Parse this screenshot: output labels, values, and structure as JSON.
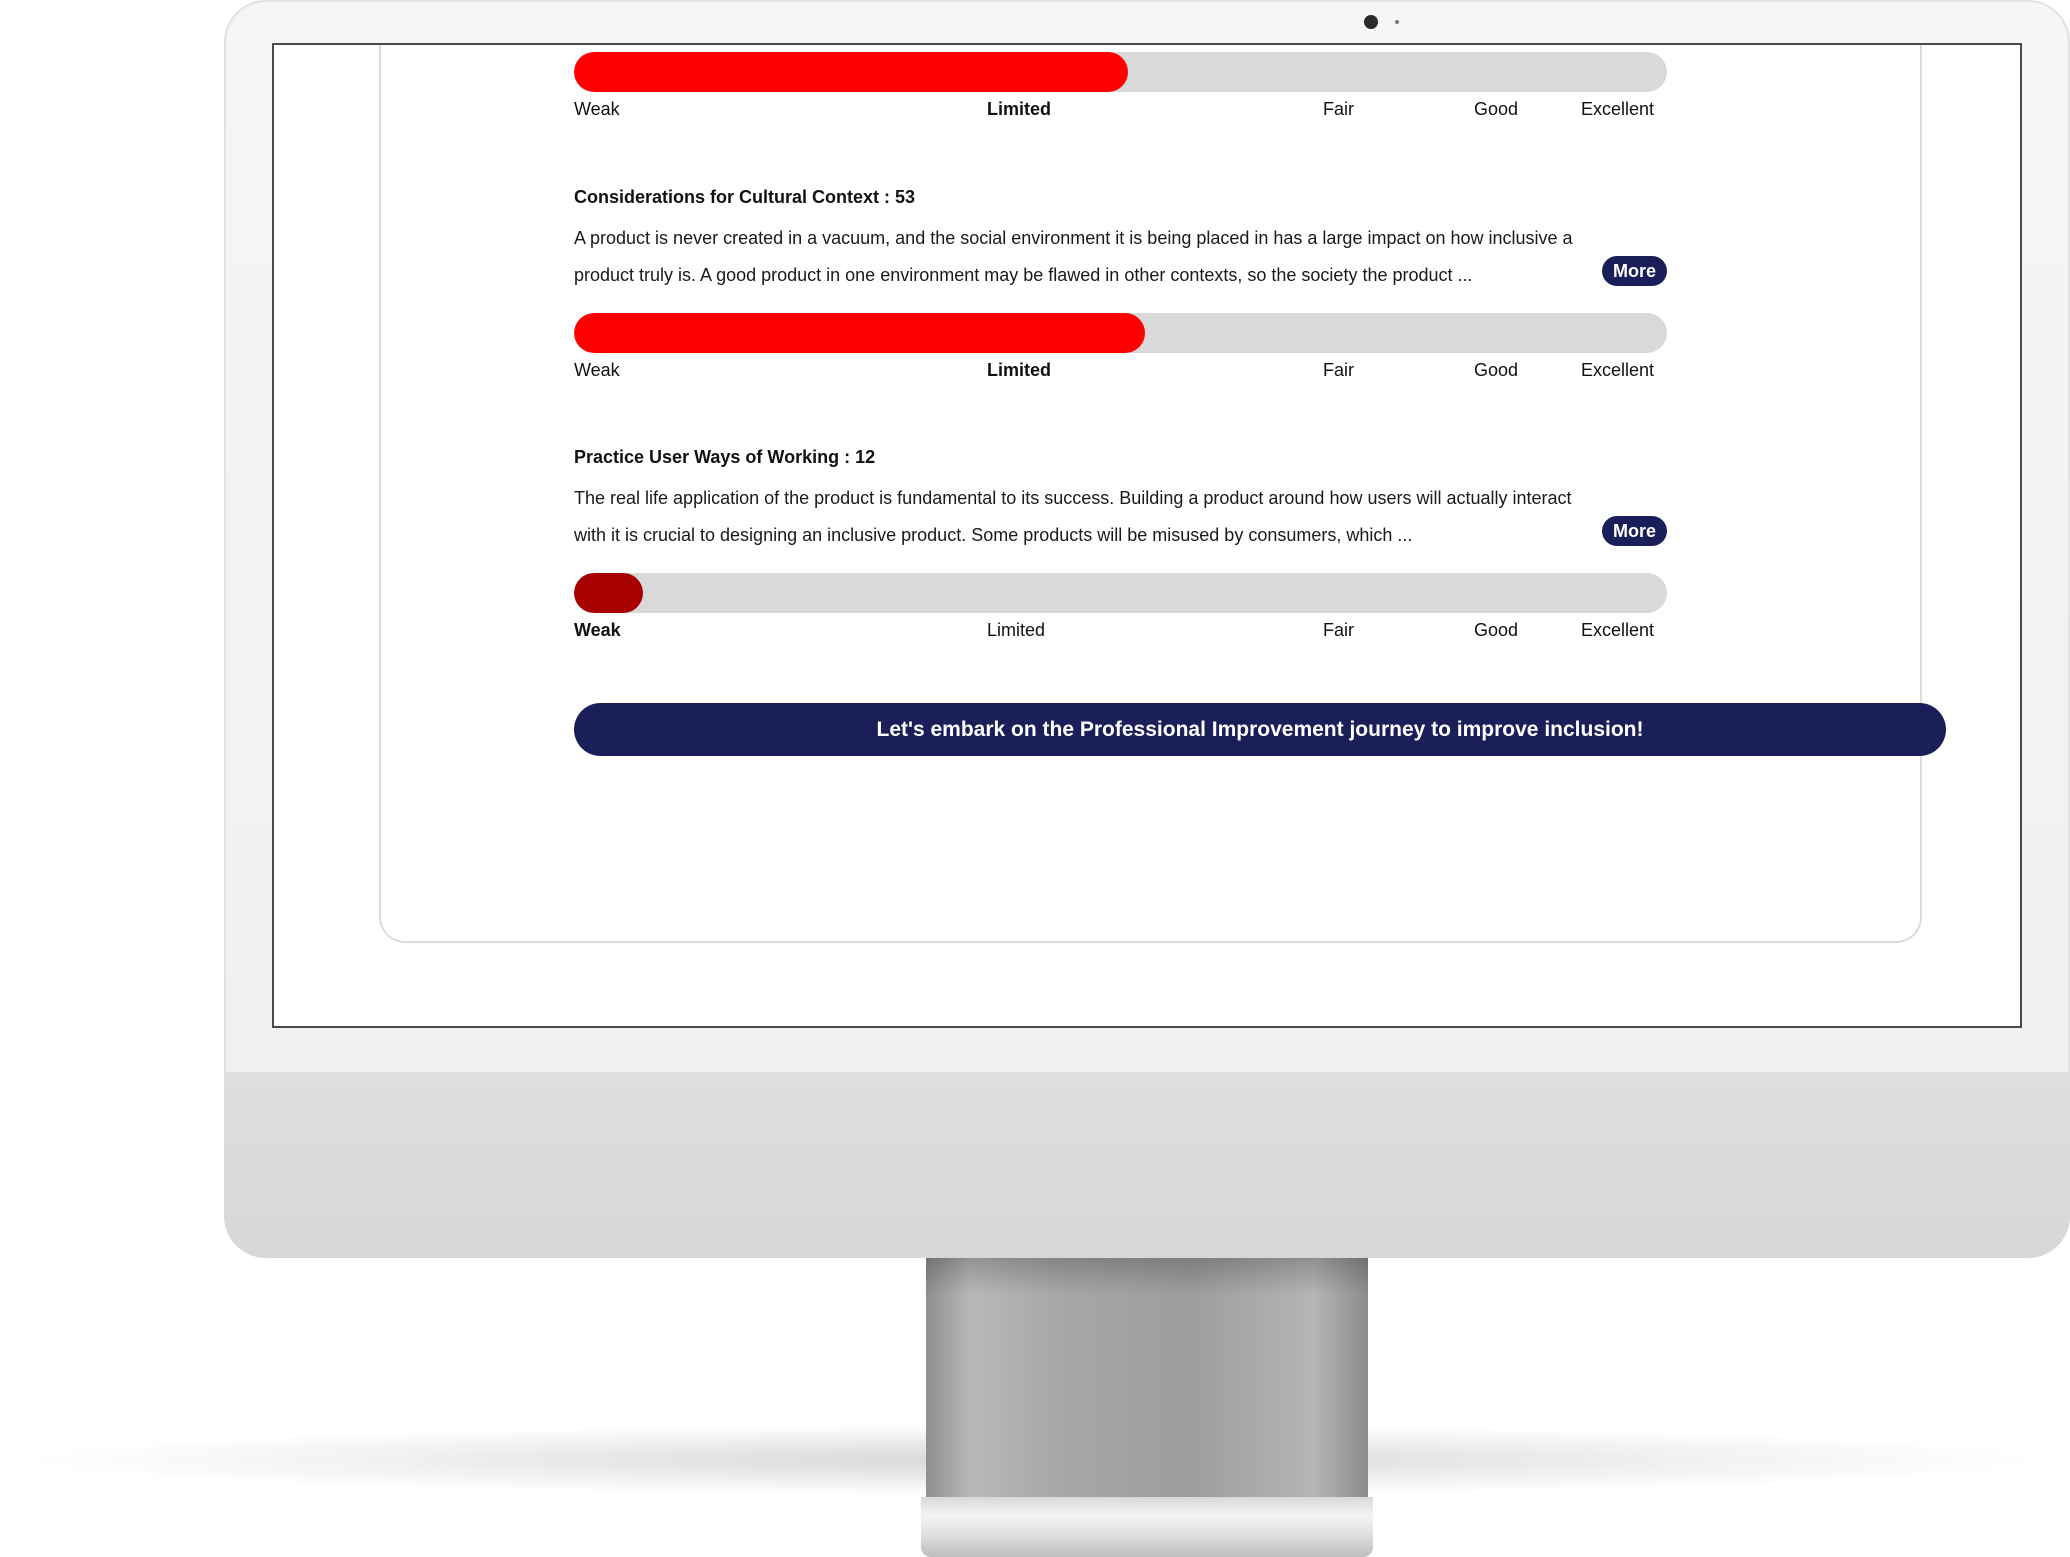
{
  "levels": [
    "Weak",
    "Limited",
    "Fair",
    "Good",
    "Excellent"
  ],
  "sections": [
    {
      "title": "",
      "description": "",
      "more_label": "",
      "progress_fraction": 0.507,
      "active_level": "Limited",
      "fill_color": "#ff0000"
    },
    {
      "title": "Considerations for Cultural Context : 53",
      "description": "A product is never created in a vacuum, and the social environment it is being placed in has a large impact on how inclusive a product truly is. A good product in one environment may be flawed in other contexts, so the society the product ...",
      "more_label": "More",
      "progress_fraction": 0.522,
      "active_level": "Limited",
      "fill_color": "#ff0000"
    },
    {
      "title": "Practice User Ways of Working : 12",
      "description": "The real life application of the product is fundamental to its success. Building a product around how users will actually interact with it is crucial to designing an inclusive product. Some products will be misused by consumers, which ...",
      "more_label": "More",
      "progress_fraction": 0.063,
      "active_level": "Weak",
      "fill_color": "#a80000"
    }
  ],
  "cta_label": "Let's embark on the Professional Improvement journey to improve inclusion!",
  "colors": {
    "accent_navy": "#1a1f5a",
    "track_gray": "#d9d9d9"
  }
}
